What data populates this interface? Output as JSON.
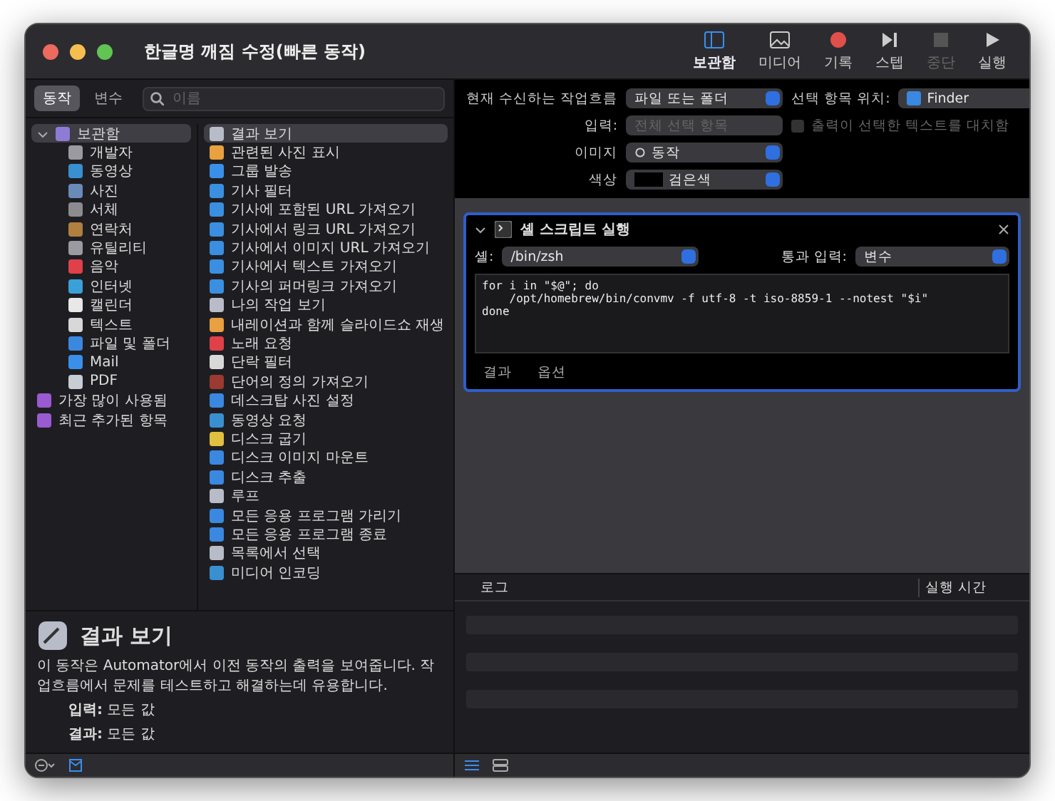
{
  "window": {
    "title": "한글명 깨짐 수정(빠른 동작)"
  },
  "toolbar": [
    {
      "kind": "library",
      "label": "보관함",
      "selected": true,
      "disabled": false
    },
    {
      "kind": "media",
      "label": "미디어",
      "selected": false,
      "disabled": false
    },
    {
      "kind": "record",
      "label": "기록",
      "selected": false,
      "disabled": false
    },
    {
      "kind": "step",
      "label": "스텝",
      "selected": false,
      "disabled": false
    },
    {
      "kind": "stop",
      "label": "중단",
      "selected": false,
      "disabled": true
    },
    {
      "kind": "run",
      "label": "실행",
      "selected": false,
      "disabled": false
    }
  ],
  "library_tabs": [
    {
      "label": "동작",
      "selected": true
    },
    {
      "label": "변수",
      "selected": false
    }
  ],
  "search": {
    "placeholder": "이름"
  },
  "categories": [
    {
      "label": "보관함",
      "color": "#8e7bd6",
      "selected": true,
      "expanded": true,
      "children": [
        {
          "label": "개발자",
          "color": "#9a9aa0"
        },
        {
          "label": "동영상",
          "color": "#3a8fd0"
        },
        {
          "label": "사진",
          "color": "#6a8ab8"
        },
        {
          "label": "서체",
          "color": "#8c8c90"
        },
        {
          "label": "연락처",
          "color": "#b08040"
        },
        {
          "label": "유틸리티",
          "color": "#9a9aa0"
        },
        {
          "label": "음악",
          "color": "#e0404a"
        },
        {
          "label": "인터넷",
          "color": "#3aa0d8"
        },
        {
          "label": "캘린더",
          "color": "#e8e8e8"
        },
        {
          "label": "텍스트",
          "color": "#d8d8d8"
        },
        {
          "label": "파일 및 폴더",
          "color": "#3a88e0"
        },
        {
          "label": "Mail",
          "color": "#3a90e8"
        },
        {
          "label": "PDF",
          "color": "#c8ccd4"
        }
      ]
    },
    {
      "label": "가장 많이 사용됨",
      "color": "#9a5ad0",
      "selected": false
    },
    {
      "label": "최근 추가된 항목",
      "color": "#9a5ad0",
      "selected": false
    }
  ],
  "actions": [
    {
      "label": "결과 보기",
      "color": "#b8bcc8",
      "selected": true
    },
    {
      "label": "관련된 사진 표시",
      "color": "#e8a040",
      "selected": false
    },
    {
      "label": "그룹 발송",
      "color": "#3a90e8",
      "selected": false
    },
    {
      "label": "기사 필터",
      "color": "#3a8fe0",
      "selected": false
    },
    {
      "label": "기사에 포함된 URL 가져오기",
      "color": "#3a8fe0",
      "selected": false
    },
    {
      "label": "기사에서 링크 URL 가져오기",
      "color": "#3a8fe0",
      "selected": false
    },
    {
      "label": "기사에서 이미지 URL 가져오기",
      "color": "#3a8fe0",
      "selected": false
    },
    {
      "label": "기사에서 텍스트 가져오기",
      "color": "#3a8fe0",
      "selected": false
    },
    {
      "label": "기사의 퍼머링크 가져오기",
      "color": "#3a8fe0",
      "selected": false
    },
    {
      "label": "나의 작업 보기",
      "color": "#b8bcc8",
      "selected": false
    },
    {
      "label": "내레이션과 함께 슬라이드쇼 재생",
      "color": "#e8a040",
      "selected": false
    },
    {
      "label": "노래 요청",
      "color": "#e0404a",
      "selected": false
    },
    {
      "label": "단락 필터",
      "color": "#d8d8d8",
      "selected": false
    },
    {
      "label": "단어의 정의 가져오기",
      "color": "#9a3a30",
      "selected": false
    },
    {
      "label": "데스크탑 사진 설정",
      "color": "#3a88e0",
      "selected": false
    },
    {
      "label": "동영상 요청",
      "color": "#3a8fd0",
      "selected": false
    },
    {
      "label": "디스크 굽기",
      "color": "#e0c040",
      "selected": false
    },
    {
      "label": "디스크 이미지 마운트",
      "color": "#3a88e0",
      "selected": false
    },
    {
      "label": "디스크 추출",
      "color": "#3a88e0",
      "selected": false
    },
    {
      "label": "루프",
      "color": "#b8bcc8",
      "selected": false
    },
    {
      "label": "모든 응용 프로그램 가리기",
      "color": "#3a88e0",
      "selected": false
    },
    {
      "label": "모든 응용 프로그램 종료",
      "color": "#3a88e0",
      "selected": false
    },
    {
      "label": "목록에서 선택",
      "color": "#b8bcc8",
      "selected": false
    },
    {
      "label": "미디어 인코딩",
      "color": "#3a8fd0",
      "selected": false
    }
  ],
  "description": {
    "title": "결과 보기",
    "text": "이 동작은 Automator에서 이전 동작의 출력을 보여줍니다. 작업흐름에서 문제를 테스트하고 해결하는데 유용합니다.",
    "details": [
      "**입력:** 모든 값",
      "**결과:** 모든 값"
    ]
  },
  "workflow_settings": {
    "receives_label": "현재 수신하는 작업흐름",
    "receives_value": "파일 또는 폴더",
    "location_label": "선택 항목 위치:",
    "location_value": "Finder",
    "input_label": "입력:",
    "input_value": "전체 선택 항목",
    "input_disabled": true,
    "replace_label": "출력이 선택한 텍스트를 대치함",
    "replace_checked": false,
    "replace_disabled": true,
    "image_label": "이미지",
    "image_value": "동작",
    "color_label": "색상",
    "color_value": "검은색"
  },
  "action": {
    "title": "셸 스크립트 실행",
    "expanded": true,
    "shell_label": "셸:",
    "shell_value": "/bin/zsh",
    "pass_label": "통과 입력:",
    "pass_value": "변수",
    "script": "for i in \"$@\"; do\n    /opt/homebrew/bin/convmv -f utf-8 -t iso-8859-1 --notest \"$i\"\ndone",
    "tabs": [
      {
        "label": "결과",
        "selected": false
      },
      {
        "label": "옵션",
        "selected": false
      }
    ]
  },
  "log": {
    "columns": [
      "로그",
      "실행 시간"
    ]
  }
}
